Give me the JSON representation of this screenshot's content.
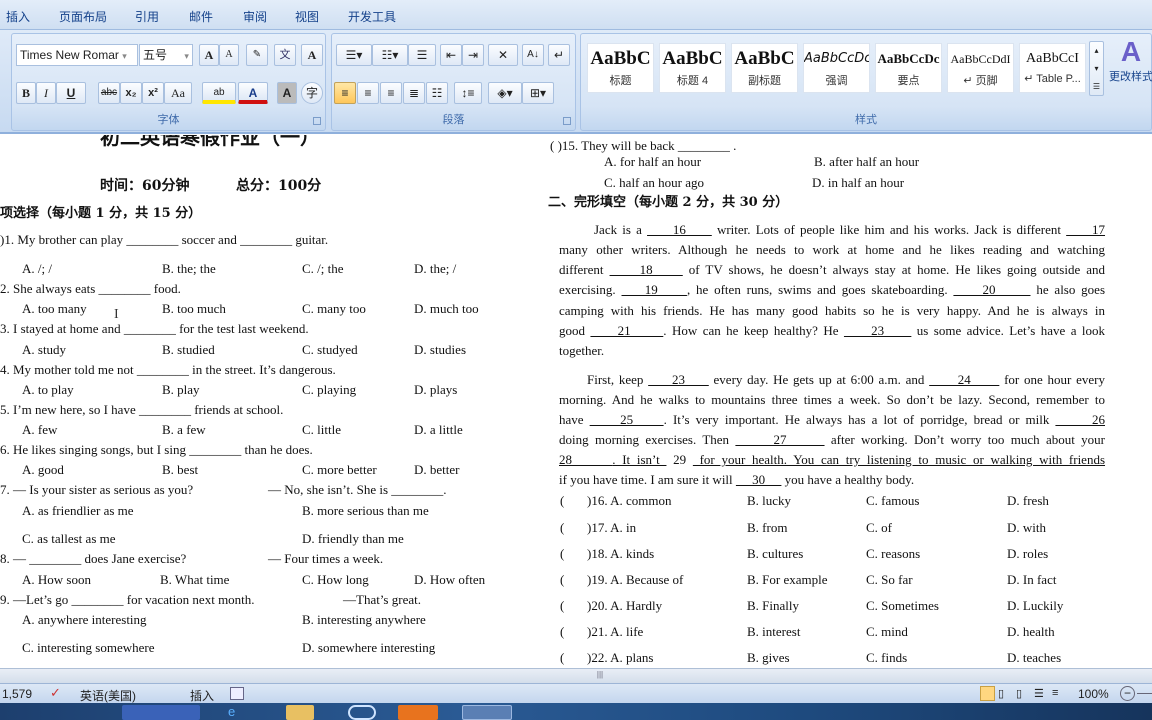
{
  "ribbon": {
    "tabs": [
      "插入",
      "页面布局",
      "引用",
      "邮件",
      "审阅",
      "视图",
      "开发工具"
    ],
    "font": {
      "name": "Times New Romar",
      "size": "五号",
      "group_label": "字体"
    },
    "paragraph": {
      "group_label": "段落"
    },
    "styles": {
      "group_label": "样式",
      "items": [
        {
          "preview": "AaBbC",
          "name": "标题"
        },
        {
          "preview": "AaBbC",
          "name": "标题 4"
        },
        {
          "preview": "AaBbC",
          "name": "副标题"
        },
        {
          "preview": "AaBbCcDc",
          "name": "强调"
        },
        {
          "preview": "AaBbCcDc",
          "name": "要点"
        },
        {
          "preview": "AaBbCcDdI",
          "name": "↵ 页脚"
        },
        {
          "preview": "AaBbCcI",
          "name": "↵ Table P..."
        }
      ],
      "change_styles": "更改样式"
    }
  },
  "document": {
    "title": "初二英语寒假作业（一）",
    "time": "时间：60分钟",
    "score": "总分：100分",
    "section1": "项选择（每小题 1 分，共 15 分）",
    "questions": [
      {
        "stem": ")1. My brother can play ________ soccer and ________ guitar.",
        "options": [
          "A. /; /",
          "B. the; the",
          "C. /; the",
          "D. the; /"
        ]
      },
      {
        "stem": "2. She always eats ________ food.",
        "options": [
          "A. too many",
          "B. too much",
          "C. many too",
          "D. much too"
        ]
      },
      {
        "stem": "3. I stayed at home and ________ for the test last weekend.",
        "options": [
          "A. study",
          "B. studied",
          "C. studyed",
          "D. studies"
        ]
      },
      {
        "stem": "4. My mother told me not ________ in the street. It’s dangerous.",
        "options": [
          "A. to play",
          "B. play",
          "C. playing",
          "D. plays"
        ]
      },
      {
        "stem": "5. I’m new here, so I have ________ friends at school.",
        "options": [
          "A. few",
          "B. a few",
          "C. little",
          "D. a little"
        ]
      },
      {
        "stem": "6. He likes singing songs, but I sing ________ than he does.",
        "options": [
          "A. good",
          "B. best",
          "C. more better",
          "D. better"
        ]
      },
      {
        "stem": "7. — Is your sister as serious as you?",
        "reply": "— No, she isn’t. She is ________.",
        "options": [
          "A. as friendlier as me",
          "B. more serious than me",
          "C. as tallest as me",
          "D. friendly than me"
        ]
      },
      {
        "stem": "8. — ________ does Jane exercise?",
        "reply": "— Four times a week.",
        "options": [
          "A. How soon",
          "B. What time",
          "C. How long",
          "D. How often"
        ]
      },
      {
        "stem": "9. —Let’s go ________ for vacation next month.",
        "reply": "—That’s great.",
        "options": [
          "A. anywhere interesting",
          "B. interesting anywhere",
          "C. interesting somewhere",
          "D. somewhere interesting"
        ]
      }
    ],
    "q15": {
      "stem": "(      )15. They will be back ________ .",
      "options": [
        "A. for half an hour",
        "B. after half an hour",
        "C. half an hour ago",
        "D. in half an hour"
      ]
    },
    "section2": "二、完形填空（每小题 2 分，共 30 分）",
    "passage1": [
      [
        "Jack is a ",
        "     16     ",
        " writer. Lots of people like him and his works. Jack is different ",
        "     17"
      ],
      [
        "many other writers. Although he needs to work at home and he likes reading and watching"
      ],
      [
        "different ",
        "     18     ",
        " of TV shows, he doesn’t always stay at  home. He likes going  outside and"
      ],
      [
        "exercising. ",
        "    19     ",
        ",  he often runs, swims and goes skateboarding. ",
        "     20      ",
        " he also goes"
      ],
      [
        "camping with his friends. He has many good habits so he is very happy. And he is always in"
      ],
      [
        "good ",
        "     21      ",
        ". How can he keep healthy? He ",
        "     23     ",
        " us some advice. Let’s have a look"
      ],
      [
        "together."
      ]
    ],
    "passage2": [
      [
        "First, keep ",
        "     23     ",
        " every day. He gets up at 6:00 a.m. and ",
        "      24      ",
        " for one hour every"
      ],
      [
        "morning. And he walks to mountains three times a week. So don’t be lazy. Second, remember to"
      ],
      [
        "have ",
        "     25     ",
        ".  It’s very important.  He always  has a lot of porridge,  bread or  milk ",
        "      26"
      ],
      [
        "doing morning exercises. Then ",
        "      27      ",
        " after working. Don’t worry too much about your"
      ],
      [
        "28      ",
        ". It isn’t ",
        "     29     ",
        " for your health. You can try listening to music or walking with friends"
      ],
      [
        "if you have time. I am sure it will ",
        "     30     ",
        " you have a healthy body."
      ]
    ],
    "answers": [
      {
        "num": ")16. A. common",
        "options": [
          "B. lucky",
          "C. famous",
          "D. fresh"
        ]
      },
      {
        "num": ")17. A. in",
        "options": [
          "B. from",
          "C. of",
          "D. with"
        ]
      },
      {
        "num": ")18. A. kinds",
        "options": [
          "B. cultures",
          "C. reasons",
          "D. roles"
        ]
      },
      {
        "num": ")19. A. Because of",
        "options": [
          "B. For example",
          "C. So far",
          "D. In fact"
        ]
      },
      {
        "num": ")20. A. Hardly",
        "options": [
          "B. Finally",
          "C. Sometimes",
          "D. Luckily"
        ]
      },
      {
        "num": ")21. A. life",
        "options": [
          "B. interest",
          "C. mind",
          "D. health"
        ]
      },
      {
        "num": ")22. A. plans",
        "options": [
          "B. gives",
          "C. finds",
          "D. teaches"
        ]
      }
    ]
  },
  "status": {
    "words": "1,579",
    "language": "英语(美国)",
    "mode": "插入",
    "zoom": "100%"
  }
}
